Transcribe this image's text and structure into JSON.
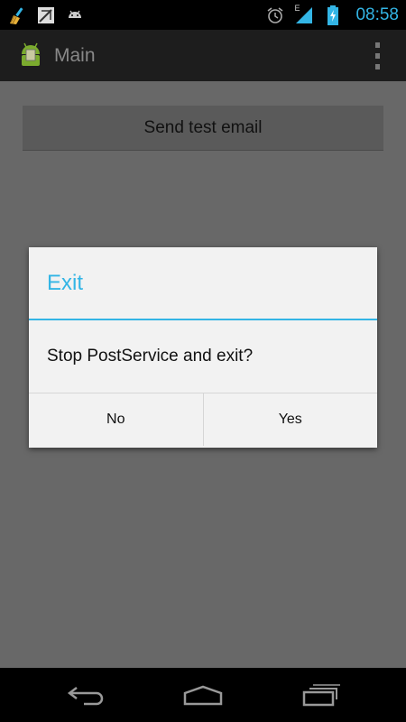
{
  "status_bar": {
    "time": "08:58",
    "left_icons": [
      "broom-icon",
      "gmail-sync-icon",
      "android-icon"
    ],
    "right_icons": [
      "alarm-icon",
      "network-edge-icon",
      "signal-icon",
      "battery-icon"
    ],
    "network_label": "E"
  },
  "action_bar": {
    "title": "Main"
  },
  "main": {
    "send_button_label": "Send test email"
  },
  "dialog": {
    "title": "Exit",
    "message": "Stop PostService and exit?",
    "buttons": [
      {
        "label": "No"
      },
      {
        "label": "Yes"
      }
    ]
  },
  "colors": {
    "accent": "#33b5e5",
    "dim_background": "#686868",
    "dialog_background": "#f2f2f2"
  }
}
